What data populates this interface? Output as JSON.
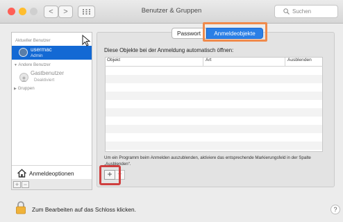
{
  "window": {
    "title": "Benutzer & Gruppen",
    "search_placeholder": "Suchen",
    "nav_back": "<",
    "nav_forward": ">",
    "traffic_lights": [
      "#ff5f56",
      "#ffbd2e",
      "#27c93f"
    ]
  },
  "sidebar": {
    "current_header": "Aktueller Benutzer",
    "current_user": {
      "name": "usermac",
      "role": "Admin"
    },
    "others_header": "Andere Benutzer",
    "guest": {
      "name": "Gastbenutzer",
      "status": "Deaktiviert"
    },
    "groups_label": "Gruppen",
    "login_options_label": "Anmeldeoptionen",
    "add_symbol": "+",
    "remove_symbol": "−"
  },
  "tabs": {
    "password": "Passwort",
    "login_items": "Anmeldeobjekte",
    "active": "login_items"
  },
  "main": {
    "instruction": "Diese Objekte bei der Anmeldung automatisch öffnen:",
    "columns": [
      "Objekt",
      "Art",
      "Ausblenden"
    ],
    "info": "Um ein Programm beim Anmelden auszublenden, aktiviere das entsprechende Markierungsfeld in der Spalte „Ausblenden“.",
    "add_symbol": "+",
    "remove_symbol": "−"
  },
  "footer": {
    "lock_text": "Zum Bearbeiten auf das Schloss klicken.",
    "help_symbol": "?"
  },
  "colors": {
    "accent": "#2a7fe6",
    "sidebar_selection": "#1369d4",
    "tab_highlight": "#f08a4b",
    "plus_highlight": "#cf3f3f"
  }
}
